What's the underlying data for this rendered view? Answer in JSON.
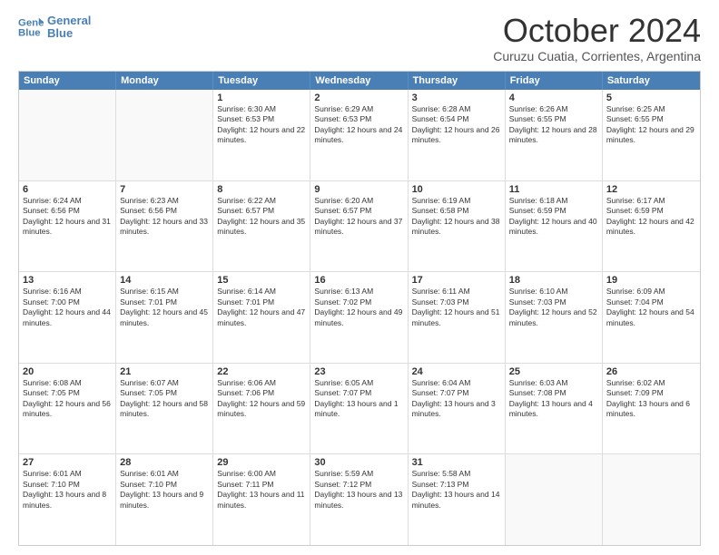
{
  "logo": {
    "line1": "General",
    "line2": "Blue"
  },
  "title": "October 2024",
  "subtitle": "Curuzu Cuatia, Corrientes, Argentina",
  "header_days": [
    "Sunday",
    "Monday",
    "Tuesday",
    "Wednesday",
    "Thursday",
    "Friday",
    "Saturday"
  ],
  "weeks": [
    [
      {
        "day": "",
        "sunrise": "",
        "sunset": "",
        "daylight": ""
      },
      {
        "day": "",
        "sunrise": "",
        "sunset": "",
        "daylight": ""
      },
      {
        "day": "1",
        "sunrise": "Sunrise: 6:30 AM",
        "sunset": "Sunset: 6:53 PM",
        "daylight": "Daylight: 12 hours and 22 minutes."
      },
      {
        "day": "2",
        "sunrise": "Sunrise: 6:29 AM",
        "sunset": "Sunset: 6:53 PM",
        "daylight": "Daylight: 12 hours and 24 minutes."
      },
      {
        "day": "3",
        "sunrise": "Sunrise: 6:28 AM",
        "sunset": "Sunset: 6:54 PM",
        "daylight": "Daylight: 12 hours and 26 minutes."
      },
      {
        "day": "4",
        "sunrise": "Sunrise: 6:26 AM",
        "sunset": "Sunset: 6:55 PM",
        "daylight": "Daylight: 12 hours and 28 minutes."
      },
      {
        "day": "5",
        "sunrise": "Sunrise: 6:25 AM",
        "sunset": "Sunset: 6:55 PM",
        "daylight": "Daylight: 12 hours and 29 minutes."
      }
    ],
    [
      {
        "day": "6",
        "sunrise": "Sunrise: 6:24 AM",
        "sunset": "Sunset: 6:56 PM",
        "daylight": "Daylight: 12 hours and 31 minutes."
      },
      {
        "day": "7",
        "sunrise": "Sunrise: 6:23 AM",
        "sunset": "Sunset: 6:56 PM",
        "daylight": "Daylight: 12 hours and 33 minutes."
      },
      {
        "day": "8",
        "sunrise": "Sunrise: 6:22 AM",
        "sunset": "Sunset: 6:57 PM",
        "daylight": "Daylight: 12 hours and 35 minutes."
      },
      {
        "day": "9",
        "sunrise": "Sunrise: 6:20 AM",
        "sunset": "Sunset: 6:57 PM",
        "daylight": "Daylight: 12 hours and 37 minutes."
      },
      {
        "day": "10",
        "sunrise": "Sunrise: 6:19 AM",
        "sunset": "Sunset: 6:58 PM",
        "daylight": "Daylight: 12 hours and 38 minutes."
      },
      {
        "day": "11",
        "sunrise": "Sunrise: 6:18 AM",
        "sunset": "Sunset: 6:59 PM",
        "daylight": "Daylight: 12 hours and 40 minutes."
      },
      {
        "day": "12",
        "sunrise": "Sunrise: 6:17 AM",
        "sunset": "Sunset: 6:59 PM",
        "daylight": "Daylight: 12 hours and 42 minutes."
      }
    ],
    [
      {
        "day": "13",
        "sunrise": "Sunrise: 6:16 AM",
        "sunset": "Sunset: 7:00 PM",
        "daylight": "Daylight: 12 hours and 44 minutes."
      },
      {
        "day": "14",
        "sunrise": "Sunrise: 6:15 AM",
        "sunset": "Sunset: 7:01 PM",
        "daylight": "Daylight: 12 hours and 45 minutes."
      },
      {
        "day": "15",
        "sunrise": "Sunrise: 6:14 AM",
        "sunset": "Sunset: 7:01 PM",
        "daylight": "Daylight: 12 hours and 47 minutes."
      },
      {
        "day": "16",
        "sunrise": "Sunrise: 6:13 AM",
        "sunset": "Sunset: 7:02 PM",
        "daylight": "Daylight: 12 hours and 49 minutes."
      },
      {
        "day": "17",
        "sunrise": "Sunrise: 6:11 AM",
        "sunset": "Sunset: 7:03 PM",
        "daylight": "Daylight: 12 hours and 51 minutes."
      },
      {
        "day": "18",
        "sunrise": "Sunrise: 6:10 AM",
        "sunset": "Sunset: 7:03 PM",
        "daylight": "Daylight: 12 hours and 52 minutes."
      },
      {
        "day": "19",
        "sunrise": "Sunrise: 6:09 AM",
        "sunset": "Sunset: 7:04 PM",
        "daylight": "Daylight: 12 hours and 54 minutes."
      }
    ],
    [
      {
        "day": "20",
        "sunrise": "Sunrise: 6:08 AM",
        "sunset": "Sunset: 7:05 PM",
        "daylight": "Daylight: 12 hours and 56 minutes."
      },
      {
        "day": "21",
        "sunrise": "Sunrise: 6:07 AM",
        "sunset": "Sunset: 7:05 PM",
        "daylight": "Daylight: 12 hours and 58 minutes."
      },
      {
        "day": "22",
        "sunrise": "Sunrise: 6:06 AM",
        "sunset": "Sunset: 7:06 PM",
        "daylight": "Daylight: 12 hours and 59 minutes."
      },
      {
        "day": "23",
        "sunrise": "Sunrise: 6:05 AM",
        "sunset": "Sunset: 7:07 PM",
        "daylight": "Daylight: 13 hours and 1 minute."
      },
      {
        "day": "24",
        "sunrise": "Sunrise: 6:04 AM",
        "sunset": "Sunset: 7:07 PM",
        "daylight": "Daylight: 13 hours and 3 minutes."
      },
      {
        "day": "25",
        "sunrise": "Sunrise: 6:03 AM",
        "sunset": "Sunset: 7:08 PM",
        "daylight": "Daylight: 13 hours and 4 minutes."
      },
      {
        "day": "26",
        "sunrise": "Sunrise: 6:02 AM",
        "sunset": "Sunset: 7:09 PM",
        "daylight": "Daylight: 13 hours and 6 minutes."
      }
    ],
    [
      {
        "day": "27",
        "sunrise": "Sunrise: 6:01 AM",
        "sunset": "Sunset: 7:10 PM",
        "daylight": "Daylight: 13 hours and 8 minutes."
      },
      {
        "day": "28",
        "sunrise": "Sunrise: 6:01 AM",
        "sunset": "Sunset: 7:10 PM",
        "daylight": "Daylight: 13 hours and 9 minutes."
      },
      {
        "day": "29",
        "sunrise": "Sunrise: 6:00 AM",
        "sunset": "Sunset: 7:11 PM",
        "daylight": "Daylight: 13 hours and 11 minutes."
      },
      {
        "day": "30",
        "sunrise": "Sunrise: 5:59 AM",
        "sunset": "Sunset: 7:12 PM",
        "daylight": "Daylight: 13 hours and 13 minutes."
      },
      {
        "day": "31",
        "sunrise": "Sunrise: 5:58 AM",
        "sunset": "Sunset: 7:13 PM",
        "daylight": "Daylight: 13 hours and 14 minutes."
      },
      {
        "day": "",
        "sunrise": "",
        "sunset": "",
        "daylight": ""
      },
      {
        "day": "",
        "sunrise": "",
        "sunset": "",
        "daylight": ""
      }
    ]
  ]
}
